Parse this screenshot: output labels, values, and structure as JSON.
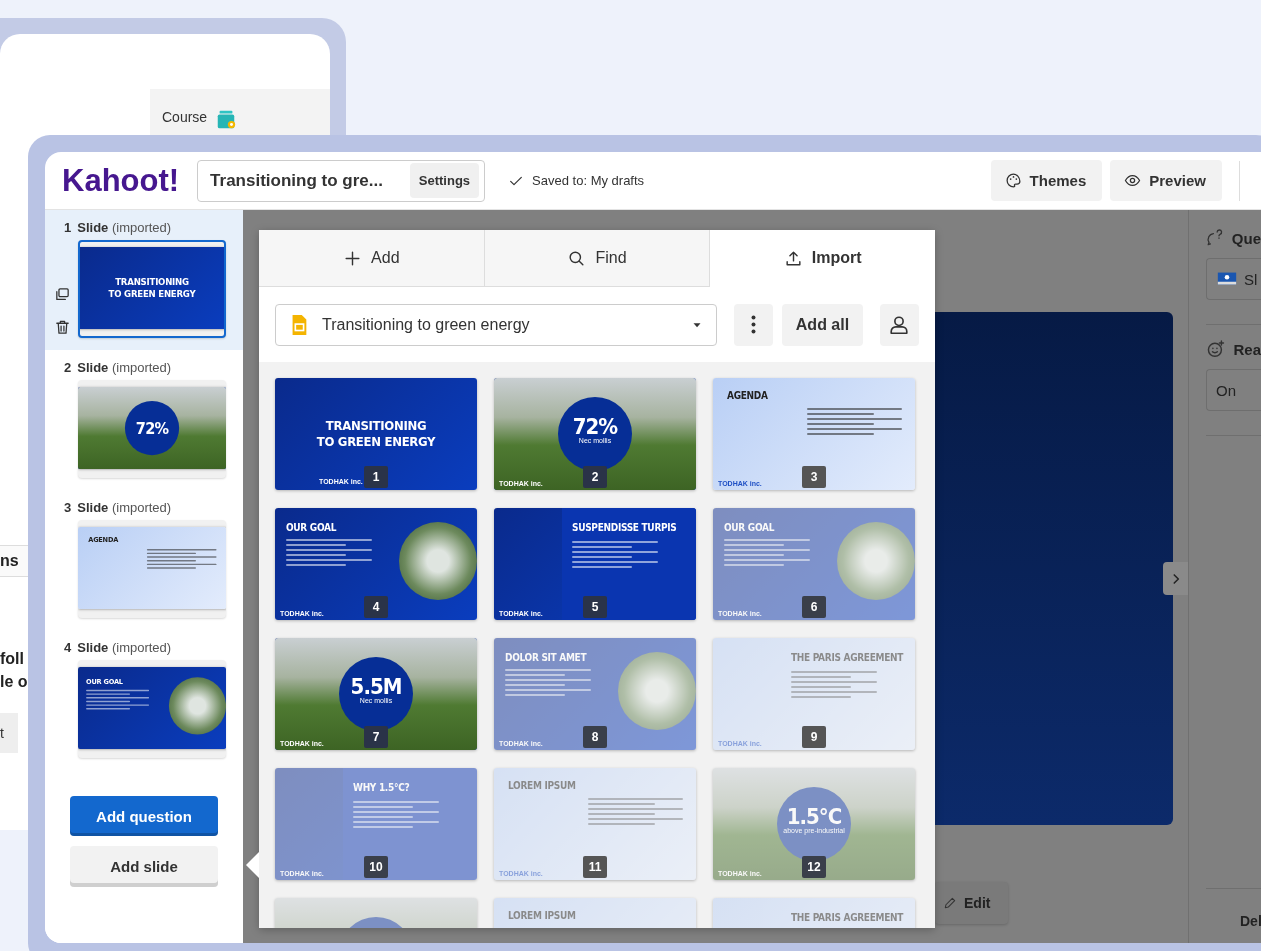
{
  "background_window": {
    "tab_label": "Course",
    "fragments": [
      {
        "kind": "heading",
        "text": "ns"
      },
      {
        "kind": "paragraph",
        "text": "foll\nle o"
      },
      {
        "kind": "button",
        "text": "t"
      }
    ]
  },
  "toolbar": {
    "logo": "Kahoot!",
    "title": "Transitioning to gre...",
    "settings": "Settings",
    "saved": "Saved to: My drafts",
    "buttons": [
      {
        "kind": "themes",
        "label": "Themes"
      },
      {
        "kind": "preview",
        "label": "Preview"
      }
    ]
  },
  "sidebar": {
    "items": [
      {
        "number": "1",
        "label": "**Slide** (imported)",
        "selected": true,
        "slide": {
          "kind": "cover",
          "dark": true,
          "title": "TRANSITIONING\nTO GREEN ENERGY",
          "dimmed": false
        }
      },
      {
        "number": "2",
        "label": "**Slide** (imported)",
        "selected": false,
        "slide": {
          "kind": "stat",
          "dark": true,
          "value": "72%",
          "dimmed": false
        }
      },
      {
        "number": "3",
        "label": "**Slide** (imported)",
        "selected": false,
        "slide": {
          "kind": "bullets",
          "dark": false,
          "title": "AGENDA",
          "dimmed": false
        }
      },
      {
        "number": "4",
        "label": "**Slide** (imported)",
        "selected": false,
        "slide": {
          "kind": "circle-photo",
          "dark": true,
          "title": "OUR GOAL",
          "dimmed": false
        }
      }
    ],
    "add_question": "Add question",
    "add_slide": "Add slide"
  },
  "import_panel": {
    "tabs": [
      {
        "kind": "add",
        "label": "Add",
        "selected": false
      },
      {
        "kind": "find",
        "label": "Find",
        "selected": false
      },
      {
        "kind": "import",
        "label": "Import",
        "selected": true
      }
    ],
    "source": "Transitioning to green energy",
    "add_all": "Add all",
    "slides": [
      {
        "number": "1",
        "kind": "cover",
        "dark": true,
        "title": "TRANSITIONING\nTO GREEN ENERGY",
        "brand": "TODHAK inc.",
        "dimmed": false
      },
      {
        "number": "2",
        "kind": "stat",
        "dark": true,
        "value": "72%",
        "caption": "Nec mollis",
        "brand": "TODHAK inc.",
        "dimmed": false
      },
      {
        "number": "3",
        "kind": "bullets",
        "dark": false,
        "title": "AGENDA",
        "brand": "TODHAK inc.",
        "dimmed": false
      },
      {
        "number": "4",
        "kind": "circle-photo",
        "dark": true,
        "title": "OUR GOAL",
        "brand": "TODHAK inc.",
        "dimmed": false
      },
      {
        "number": "5",
        "kind": "photo-bullets",
        "dark": true,
        "title": "SUSPENDISSE TURPIS",
        "brand": "TODHAK inc.",
        "dimmed": false
      },
      {
        "number": "6",
        "kind": "circle-photo",
        "dark": true,
        "title": "OUR GOAL",
        "brand": "TODHAK inc.",
        "dimmed": true
      },
      {
        "number": "7",
        "kind": "stat",
        "dark": true,
        "value": "5.5M",
        "caption": "Nec mollis",
        "brand": "TODHAK inc.",
        "dimmed": false
      },
      {
        "number": "8",
        "kind": "circle-photo",
        "dark": true,
        "title": "DOLOR SIT AMET",
        "brand": "TODHAK inc.",
        "dimmed": true
      },
      {
        "number": "9",
        "kind": "photo-bullets",
        "dark": false,
        "title": "THE PARIS AGREEMENT",
        "brand": "TODHAK inc.",
        "dimmed": true
      },
      {
        "number": "10",
        "kind": "photo-bullets",
        "dark": true,
        "title": "WHY 1.5°C?",
        "brand": "TODHAK inc.",
        "dimmed": true
      },
      {
        "number": "11",
        "kind": "bullets",
        "dark": false,
        "title": "LOREM IPSUM",
        "brand": "TODHAK inc.",
        "dimmed": true
      },
      {
        "number": "12",
        "kind": "stat",
        "dark": true,
        "value": "1.5°C",
        "caption": "above pre-industrial",
        "brand": "TODHAK inc.",
        "dimmed": true
      },
      {
        "kind": "stat",
        "dark": true,
        "dimmed": true
      },
      {
        "kind": "bullets",
        "dark": false,
        "title": "LOREM IPSUM",
        "dimmed": true
      },
      {
        "kind": "photo-bullets",
        "dark": false,
        "title": "THE PARIS AGREEMENT",
        "dimmed": true
      }
    ]
  },
  "editor": {
    "edit_button": "Edit"
  },
  "settings_panel": {
    "sections": [
      {
        "kind": "question-type",
        "heading": "Que",
        "value": "Sl"
      },
      {
        "kind": "reactions",
        "heading": "Rea",
        "value": "On"
      }
    ],
    "footer_button": "Del"
  }
}
